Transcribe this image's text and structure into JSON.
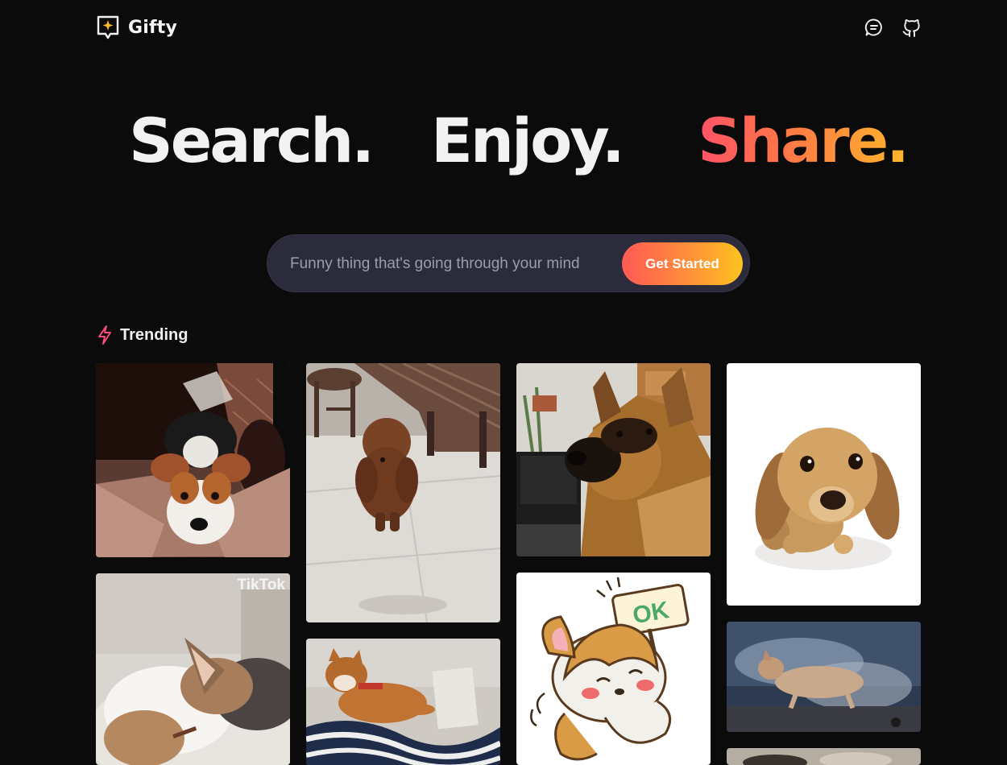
{
  "app": {
    "brand_name": "Gifty",
    "colors": {
      "background": "#0b0b0c",
      "brand_gradient_start": "#ff5267",
      "brand_gradient_end": "#ffb62b",
      "search_bg": "#2b2b3b",
      "logo_accent": "#ffbf2b"
    }
  },
  "header": {
    "logo_icon": "chat-sparkle-logo-icon",
    "feedback_icon": "chat-bubble-icon",
    "github_icon": "github-icon"
  },
  "hero": {
    "word1": "Search.",
    "word2": "Enjoy.",
    "word3": "Share."
  },
  "search": {
    "placeholder": "Funny thing that's going through your mind",
    "button_label": "Get Started"
  },
  "trending": {
    "icon": "lightning-icon",
    "label": "Trending"
  },
  "gifs": [
    {
      "name": "gif-jack-russell-on-couch"
    },
    {
      "name": "gif-brown-poodle-standing"
    },
    {
      "name": "gif-german-shepherd"
    },
    {
      "name": "gif-dachshund-puppy"
    },
    {
      "name": "gif-corgi-tiktok",
      "overlay": "TikTok"
    },
    {
      "name": "gif-shiba-on-laptop"
    },
    {
      "name": "gif-cartoon-corgi-ok",
      "sign": "OK"
    },
    {
      "name": "gif-running-corgi"
    }
  ]
}
